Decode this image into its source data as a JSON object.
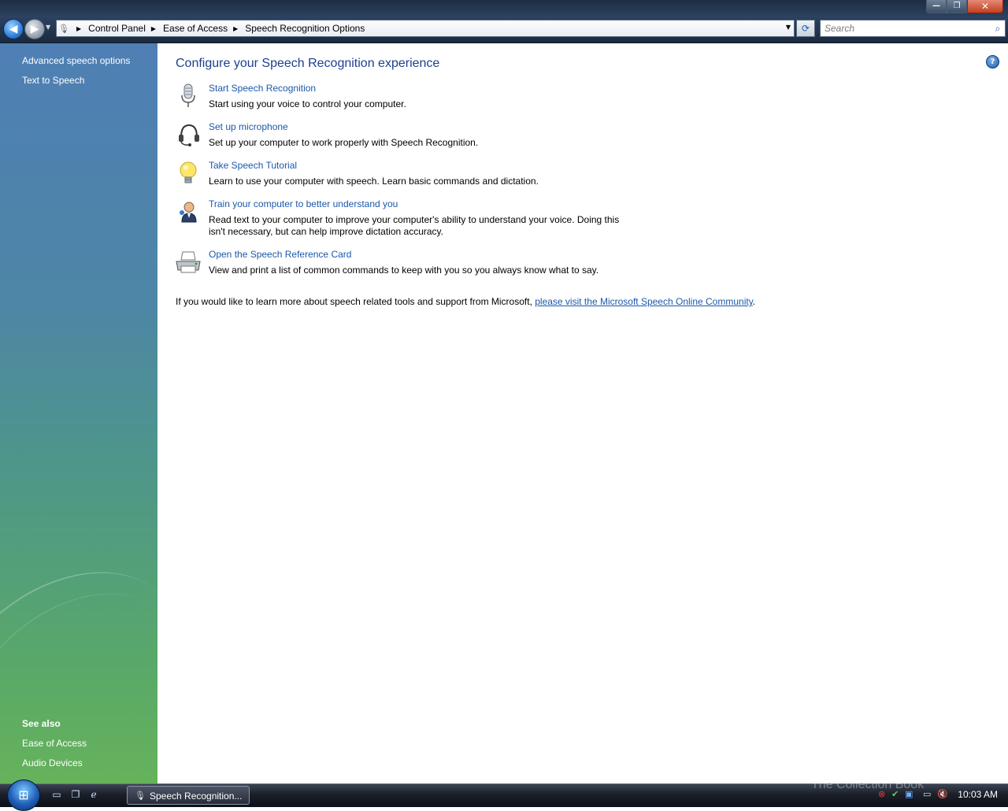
{
  "window": {
    "min_label": "—",
    "max_label": "❐",
    "close_label": "✕"
  },
  "nav": {
    "back_glyph": "◀",
    "forward_glyph": "▶"
  },
  "breadcrumb": {
    "items": [
      "Control Panel",
      "Ease of Access",
      "Speech Recognition Options"
    ]
  },
  "search": {
    "placeholder": "Search"
  },
  "left_pane": {
    "tasks": [
      "Advanced speech options",
      "Text to Speech"
    ],
    "see_also_heading": "See also",
    "see_also": [
      "Ease of Access",
      "Audio Devices"
    ]
  },
  "main": {
    "title": "Configure your Speech Recognition experience",
    "tasks": [
      {
        "icon": "microphone-icon",
        "label": "Start Speech Recognition",
        "description": "Start using your voice to control your computer."
      },
      {
        "icon": "headset-icon",
        "label": "Set up microphone",
        "description": "Set up your computer to work properly with Speech Recognition."
      },
      {
        "icon": "lightbulb-icon",
        "label": "Take Speech Tutorial",
        "description": "Learn to use your computer with speech.  Learn basic commands and dictation."
      },
      {
        "icon": "user-train-icon",
        "label": "Train your computer to better understand you",
        "description": "Read text to your computer to improve your computer's ability to understand your voice.  Doing this isn't necessary, but can help improve dictation accuracy."
      },
      {
        "icon": "printer-icon",
        "label": "Open the Speech Reference Card",
        "description": "View and print a list of common commands to keep with you so you always know what to say."
      }
    ],
    "footer_text": "If you would like to learn more about speech related tools and support from Microsoft, ",
    "footer_link": "please visit the Microsoft Speech Online Community",
    "footer_end": "."
  },
  "taskbar": {
    "window_button": "Speech Recognition...",
    "clock": "10:03 AM",
    "watermark": "The Collection Book"
  }
}
